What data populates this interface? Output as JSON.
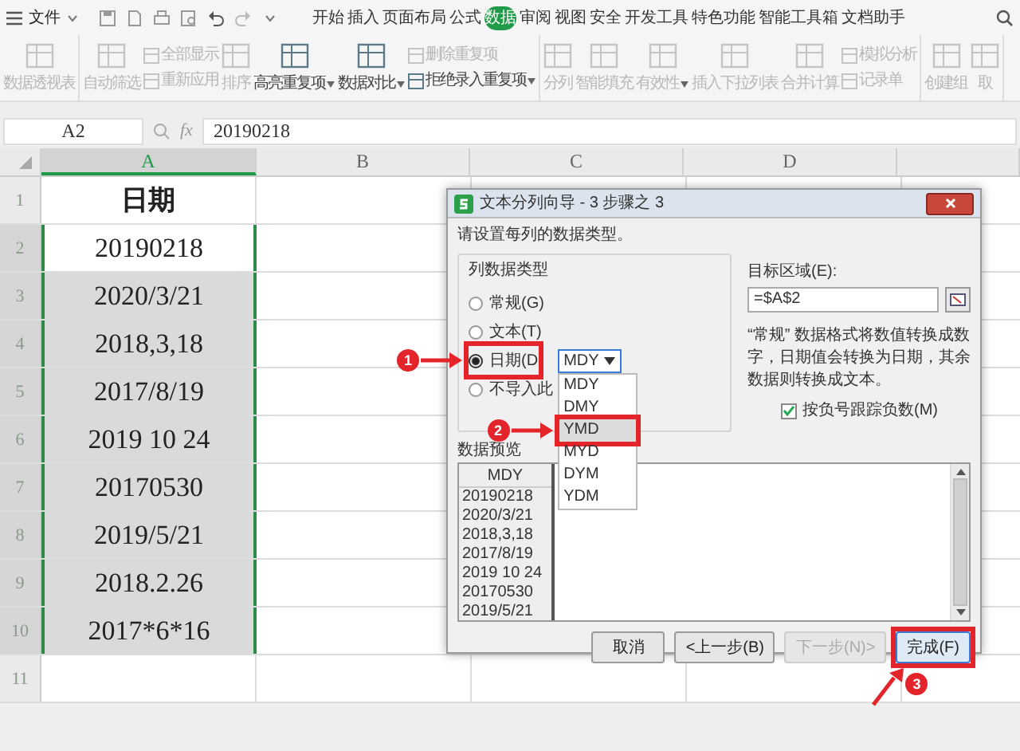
{
  "app_menu": {
    "label": "文件"
  },
  "menu_tabs": [
    {
      "label": "开始",
      "selected": false
    },
    {
      "label": "插入",
      "selected": false
    },
    {
      "label": "页面布局",
      "selected": false
    },
    {
      "label": "公式",
      "selected": false
    },
    {
      "label": "数据",
      "selected": true
    },
    {
      "label": "审阅",
      "selected": false
    },
    {
      "label": "视图",
      "selected": false
    },
    {
      "label": "安全",
      "selected": false
    },
    {
      "label": "开发工具",
      "selected": false
    },
    {
      "label": "特色功能",
      "selected": false
    },
    {
      "label": "智能工具箱",
      "selected": false
    },
    {
      "label": "文档助手",
      "selected": false
    }
  ],
  "ribbon_groups": [
    {
      "items": [
        {
          "kind": "large",
          "label": "数据透视表",
          "dropdown": false,
          "disabled": true
        }
      ]
    },
    {
      "items": [
        {
          "kind": "large",
          "label": "自动筛选",
          "dropdown": false,
          "disabled": true
        },
        {
          "kind": "stack",
          "rows": [
            {
              "label": "全部显示",
              "dropdown": false,
              "disabled": true
            },
            {
              "label": "重新应用",
              "dropdown": false,
              "disabled": true
            }
          ]
        },
        {
          "kind": "large",
          "label": "排序",
          "dropdown": false,
          "disabled": true
        },
        {
          "kind": "large",
          "label": "高亮重复项",
          "dropdown": true,
          "disabled": false
        },
        {
          "kind": "large",
          "label": "数据对比",
          "dropdown": true,
          "disabled": false
        },
        {
          "kind": "stack",
          "rows": [
            {
              "label": "删除重复项",
              "dropdown": false,
              "disabled": true
            },
            {
              "label": "拒绝录入重复项",
              "dropdown": true,
              "disabled": false
            }
          ]
        }
      ]
    },
    {
      "items": [
        {
          "kind": "large",
          "label": "分列",
          "dropdown": false,
          "disabled": true
        },
        {
          "kind": "large",
          "label": "智能填充",
          "dropdown": false,
          "disabled": true
        },
        {
          "kind": "large",
          "label": "有效性",
          "dropdown": true,
          "disabled": true
        },
        {
          "kind": "large",
          "label": "插入下拉列表",
          "dropdown": false,
          "disabled": true
        },
        {
          "kind": "large",
          "label": "合并计算",
          "dropdown": false,
          "disabled": true
        },
        {
          "kind": "stack",
          "rows": [
            {
              "label": "模拟分析",
              "dropdown": false,
              "disabled": true
            },
            {
              "label": "记录单",
              "dropdown": false,
              "disabled": true
            }
          ]
        }
      ]
    },
    {
      "items": [
        {
          "kind": "large",
          "label": "创建组",
          "dropdown": false,
          "disabled": true
        },
        {
          "kind": "large",
          "label": "取",
          "dropdown": false,
          "disabled": true
        }
      ]
    }
  ],
  "formula_bar": {
    "name_box": "A2",
    "fx_label": "fx",
    "formula": "20190218"
  },
  "sheet": {
    "columns": [
      {
        "label": "A",
        "selected": true
      },
      {
        "label": "B",
        "selected": false
      },
      {
        "label": "C",
        "selected": false
      },
      {
        "label": "D",
        "selected": false
      }
    ],
    "rows": [
      {
        "header": "1",
        "selected": false,
        "value": "日期",
        "active": false,
        "bold": true
      },
      {
        "header": "2",
        "selected": true,
        "value": "20190218",
        "active": true,
        "bold": false
      },
      {
        "header": "3",
        "selected": true,
        "value": "2020/3/21",
        "active": false,
        "bold": false
      },
      {
        "header": "4",
        "selected": true,
        "value": "2018,3,18",
        "active": false,
        "bold": false
      },
      {
        "header": "5",
        "selected": true,
        "value": "2017/8/19",
        "active": false,
        "bold": false
      },
      {
        "header": "6",
        "selected": true,
        "value": "2019 10 24",
        "active": false,
        "bold": false
      },
      {
        "header": "7",
        "selected": true,
        "value": "20170530",
        "active": false,
        "bold": false
      },
      {
        "header": "8",
        "selected": true,
        "value": "2019/5/21",
        "active": false,
        "bold": false
      },
      {
        "header": "9",
        "selected": true,
        "value": "2018.2.26",
        "active": false,
        "bold": false
      },
      {
        "header": "10",
        "selected": true,
        "value": "2017*6*16",
        "active": false,
        "bold": false
      },
      {
        "header": "11",
        "selected": false
      }
    ]
  },
  "dialog": {
    "title": "文本分列向导 - 3 步骤之 3",
    "instruction": "请设置每列的数据类型。",
    "column_type": {
      "title": "列数据类型",
      "options": [
        {
          "label": "常规(G)",
          "selected": false
        },
        {
          "label": "文本(T)",
          "selected": false
        },
        {
          "label": "日期(D",
          "selected": true,
          "marker": "1"
        },
        {
          "label": "不导入此",
          "selected": false
        }
      ]
    },
    "date_format": {
      "value": "MDY",
      "options": [
        {
          "label": "MDY",
          "highlighted": false
        },
        {
          "label": "DMY",
          "highlighted": false
        },
        {
          "label": "YMD",
          "highlighted": true,
          "marker": "2"
        },
        {
          "label": "MYD",
          "highlighted": false
        },
        {
          "label": "DYM",
          "highlighted": false
        },
        {
          "label": "YDM",
          "highlighted": false
        }
      ]
    },
    "target_label": "目标区域(E):",
    "target_value": "=$A$2",
    "description": "“常规” 数据格式将数值转换成数字，日期值会转换为日期，其余数据则转换成文本。",
    "negative_checkbox": {
      "label": "按负号跟踪负数(M)",
      "checked": true
    },
    "preview": {
      "label": "数据预览",
      "header": "MDY",
      "rows": [
        "20190218",
        "2020/3/21",
        "2018,3,18",
        "2017/8/19",
        "2019 10 24",
        "20170530",
        "2019/5/21"
      ]
    },
    "buttons": [
      {
        "label": "取消",
        "disabled": false
      },
      {
        "label": "<上一步(B)",
        "disabled": false
      },
      {
        "label": "下一步(N)>",
        "disabled": true
      },
      {
        "label": "完成(F)",
        "disabled": false,
        "marker": "3"
      }
    ]
  }
}
